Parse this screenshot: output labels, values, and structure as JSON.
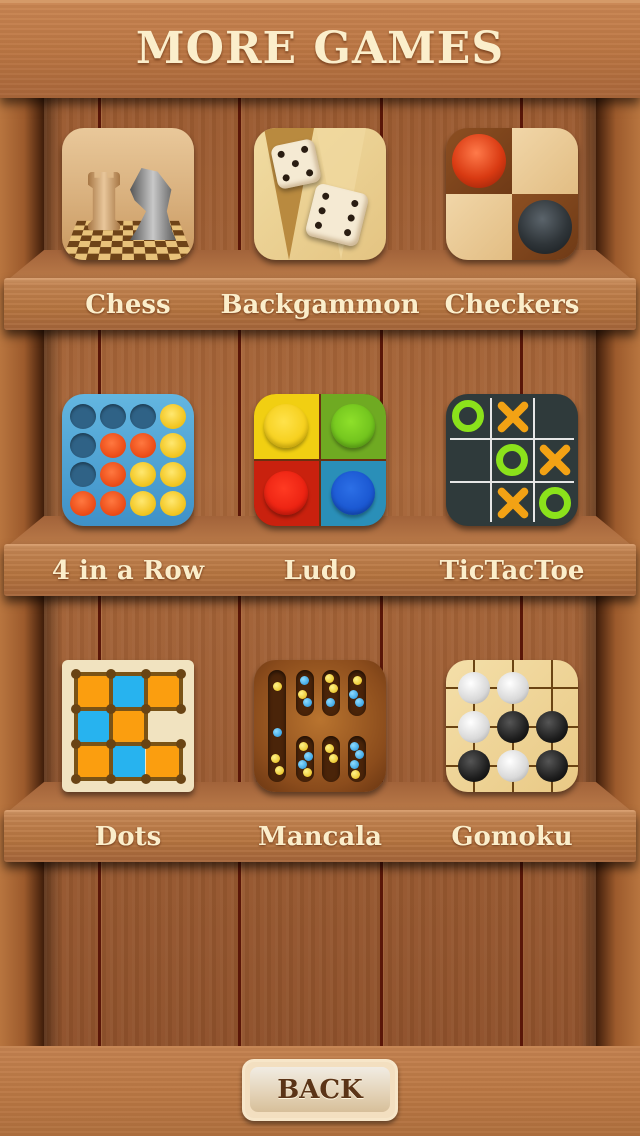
{
  "header": {
    "title": "MORE GAMES"
  },
  "games": [
    {
      "id": "chess",
      "label": "Chess",
      "icon": "chess-icon"
    },
    {
      "id": "backgammon",
      "label": "Backgammon",
      "icon": "backgammon-icon"
    },
    {
      "id": "checkers",
      "label": "Checkers",
      "icon": "checkers-icon"
    },
    {
      "id": "four-in-a-row",
      "label": "4 in a Row",
      "icon": "four-in-a-row-icon"
    },
    {
      "id": "ludo",
      "label": "Ludo",
      "icon": "ludo-icon"
    },
    {
      "id": "tictactoe",
      "label": "TicTacToe",
      "icon": "tictactoe-icon"
    },
    {
      "id": "dots",
      "label": "Dots",
      "icon": "dots-icon"
    },
    {
      "id": "mancala",
      "label": "Mancala",
      "icon": "mancala-icon"
    },
    {
      "id": "gomoku",
      "label": "Gomoku",
      "icon": "gomoku-icon"
    }
  ],
  "footer": {
    "back_label": "BACK"
  },
  "colors": {
    "label_text": "#fbeecb",
    "wood_dark": "#6b3a1c",
    "wood_light": "#c48250",
    "button_text": "#5b3417",
    "ludo_yellow": "#f7d21a",
    "ludo_green": "#6fbf1d",
    "ludo_red": "#e32512",
    "ludo_blue": "#1a5fd6"
  }
}
